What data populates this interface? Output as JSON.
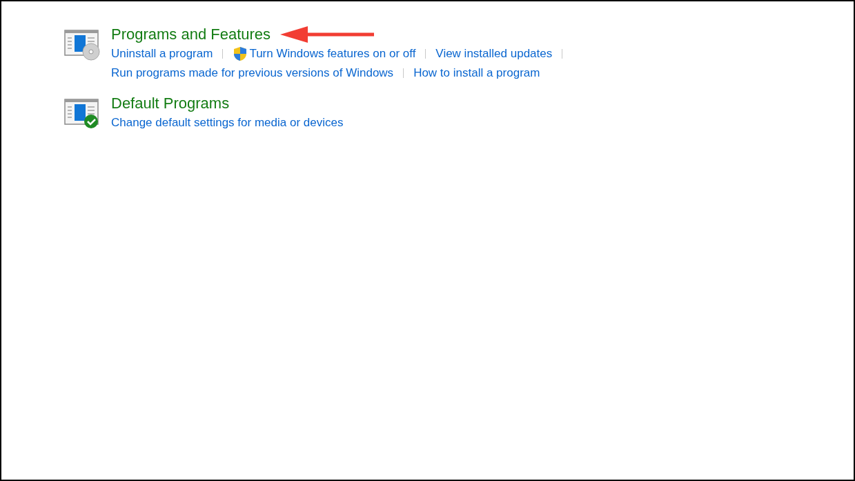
{
  "sections": [
    {
      "kind": "programs",
      "title": "Programs and Features",
      "annotated": true,
      "lines": [
        [
          {
            "label": "Uninstall a program",
            "shield": false
          },
          {
            "label": "Turn Windows features on or off",
            "shield": true
          },
          {
            "label": "View installed updates",
            "shield": false
          }
        ],
        [
          {
            "label": "Run programs made for previous versions of Windows",
            "shield": false
          },
          {
            "label": "How to install a program",
            "shield": false
          }
        ]
      ]
    },
    {
      "kind": "defaults",
      "title": "Default Programs",
      "annotated": false,
      "lines": [
        [
          {
            "label": "Change default settings for media or devices",
            "shield": false
          }
        ]
      ]
    }
  ]
}
